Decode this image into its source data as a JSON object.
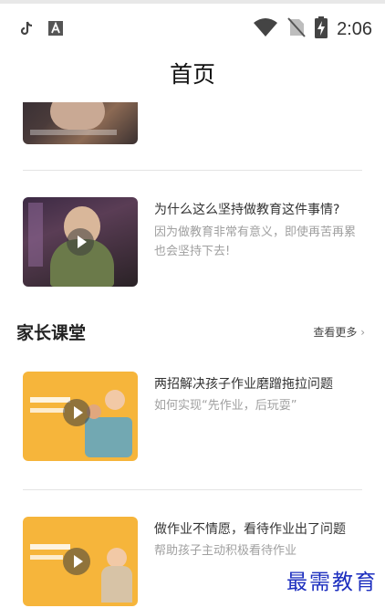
{
  "status_bar": {
    "time": "2:06"
  },
  "header": {
    "title": "首页"
  },
  "feed": {
    "featured": [
      {
        "title": "为什么这么坚持做教育这件事情?",
        "description": "因为做教育非常有意义，即使再苦再累也会坚持下去!"
      }
    ]
  },
  "parent_class": {
    "title": "家长课堂",
    "more_label": "查看更多",
    "items": [
      {
        "title": "两招解决孩子作业磨蹭拖拉问题",
        "subtitle": "如何实现“先作业，后玩耍”"
      },
      {
        "title": "做作业不情愿，看待作业出了问题",
        "subtitle": "帮助孩子主动积极看待作业"
      }
    ]
  },
  "watermark": "最需教育",
  "colors": {
    "thumb_orange": "#f6b53b",
    "watermark": "#1d2fbf",
    "muted_text": "#a0a0a0"
  }
}
